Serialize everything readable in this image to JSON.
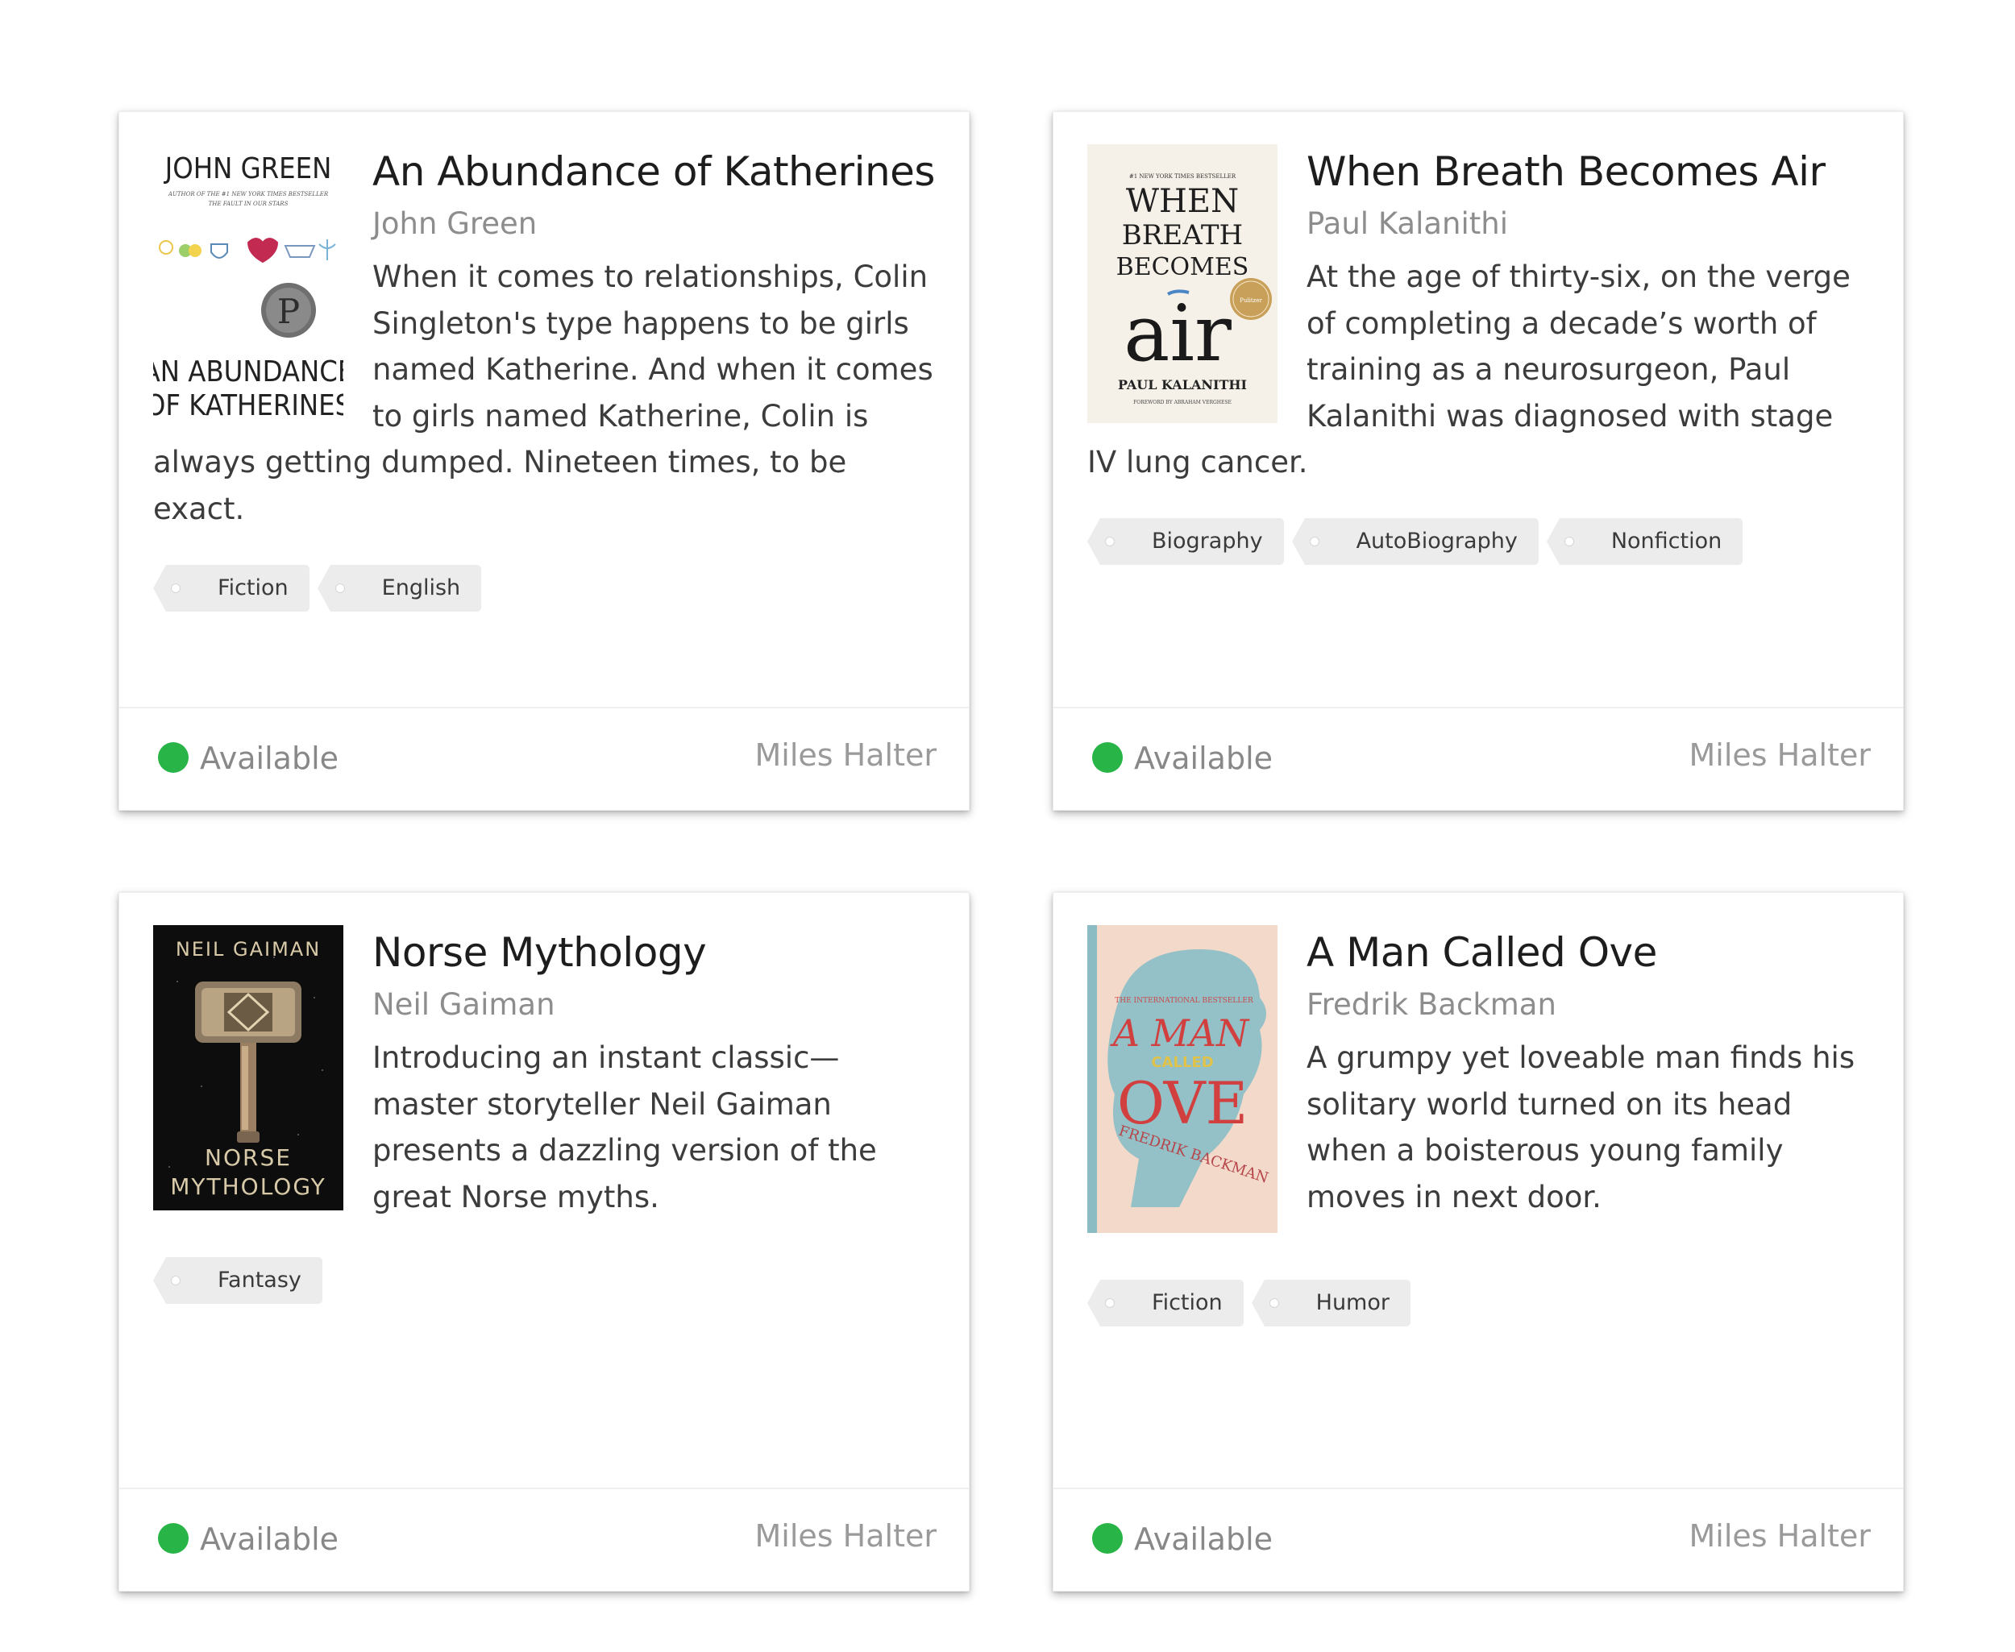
{
  "books": [
    {
      "title": "An Abundance of Katherines",
      "author": "John Green",
      "description": "When it comes to relationships, Colin Singleton's type happens to be girls named Katherine. And when it comes to girls named Katherine, Colin is always getting dumped. Nineteen times, to be exact.",
      "tags": [
        "Fiction",
        "English"
      ],
      "status": "Available",
      "owner": "Miles Halter",
      "cover": {
        "author_text": "JOHN GREEN",
        "tagline": "AUTHOR OF THE #1 NEW YORK TIMES BESTSELLER THE FAULT IN OUR STARS",
        "badge": "P",
        "title_line1": "AN ABUNDANCE",
        "title_line2": "OF KATHERINES"
      }
    },
    {
      "title": "When Breath Becomes Air",
      "author": "Paul Kalanithi",
      "description": "At the age of thirty-six, on the verge of completing a decade’s worth of training as a neurosurgeon, Paul Kalanithi was diagnosed with stage IV lung cancer.",
      "tags": [
        "Biography",
        "AutoBiography",
        "Nonfiction"
      ],
      "status": "Available",
      "owner": "Miles Halter",
      "cover": {
        "top_text": "#1 NEW YORK TIMES BESTSELLER",
        "line1": "WHEN",
        "line2": "BREATH",
        "line3": "BECOMES",
        "line4": "air",
        "seal": "Finalist Pulitzer Prize",
        "author_text": "PAUL KALANITHI",
        "foreword": "FOREWORD BY ABRAHAM VERGHESE"
      }
    },
    {
      "title": "Norse Mythology",
      "author": "Neil Gaiman",
      "description": "Introducing an instant classic—master storyteller Neil Gaiman presents a dazzling version of the great Norse myths.",
      "tags": [
        "Fantasy"
      ],
      "status": "Available",
      "owner": "Miles Halter",
      "cover": {
        "author_text": "NEIL GAIMAN",
        "title_line1": "NORSE",
        "title_line2": "MYTHOLOGY"
      }
    },
    {
      "title": "A Man Called Ove",
      "author": "Fredrik Backman",
      "description": "A grumpy yet loveable man finds his solitary world turned on its head when a boisterous young family moves in next door.",
      "tags": [
        "Fiction",
        "Humor"
      ],
      "status": "Available",
      "owner": "Miles Halter",
      "cover": {
        "top_text": "THE INTERNATIONAL BESTSELLER",
        "line1": "A MAN",
        "line2": "CALLED",
        "line3": "OVE",
        "author_text": "FREDRIK BACKMAN"
      }
    }
  ],
  "colors": {
    "status_available": "#28b446",
    "tag_bg": "#ececec",
    "title": "#1d1d1d",
    "muted": "#8d8d8d"
  }
}
